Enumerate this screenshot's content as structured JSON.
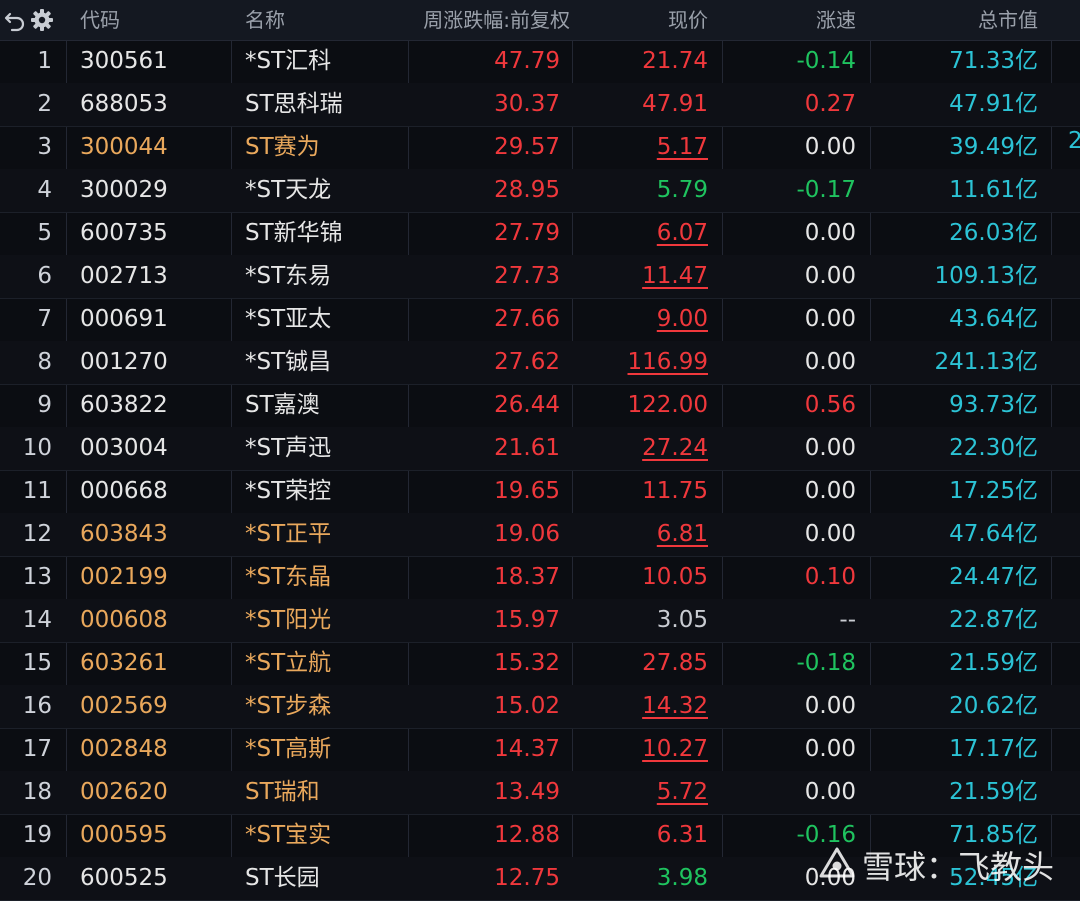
{
  "header": {
    "code": "代码",
    "name": "名称",
    "weekly_change": "周涨跌幅:前复权",
    "price": "现价",
    "speed": "涨速",
    "market_cap": "总市值"
  },
  "icons": {
    "refresh": "refresh-icon",
    "settings": "gear-icon"
  },
  "colors": {
    "red": "#f0383c",
    "green": "#1fc35f",
    "cyan": "#2cc3d5",
    "orange": "#e9a85c"
  },
  "rows": [
    {
      "idx": "1",
      "code": "300561",
      "name": "*ST汇科",
      "chg": "47.79",
      "price": "21.74",
      "price_color": "red",
      "price_ul": false,
      "speed": "-0.14",
      "speed_color": "green",
      "cap": "71.33亿",
      "name_color": "white"
    },
    {
      "idx": "2",
      "code": "688053",
      "name": "ST思科瑞",
      "chg": "30.37",
      "price": "47.91",
      "price_color": "red",
      "price_ul": false,
      "speed": "0.27",
      "speed_color": "red",
      "cap": "47.91亿",
      "name_color": "white"
    },
    {
      "idx": "3",
      "code": "300044",
      "name": "ST赛为",
      "chg": "29.57",
      "price": "5.17",
      "price_color": "red",
      "price_ul": true,
      "speed": "0.00",
      "speed_color": "white",
      "cap": "39.49亿",
      "name_color": "orange"
    },
    {
      "idx": "4",
      "code": "300029",
      "name": "*ST天龙",
      "chg": "28.95",
      "price": "5.79",
      "price_color": "green",
      "price_ul": false,
      "speed": "-0.17",
      "speed_color": "green",
      "cap": "11.61亿",
      "name_color": "white"
    },
    {
      "idx": "5",
      "code": "600735",
      "name": "ST新华锦",
      "chg": "27.79",
      "price": "6.07",
      "price_color": "red",
      "price_ul": true,
      "speed": "0.00",
      "speed_color": "white",
      "cap": "26.03亿",
      "name_color": "white"
    },
    {
      "idx": "6",
      "code": "002713",
      "name": "*ST东易",
      "chg": "27.73",
      "price": "11.47",
      "price_color": "red",
      "price_ul": true,
      "speed": "0.00",
      "speed_color": "white",
      "cap": "109.13亿",
      "name_color": "white"
    },
    {
      "idx": "7",
      "code": "000691",
      "name": "*ST亚太",
      "chg": "27.66",
      "price": "9.00",
      "price_color": "red",
      "price_ul": true,
      "speed": "0.00",
      "speed_color": "white",
      "cap": "43.64亿",
      "name_color": "white"
    },
    {
      "idx": "8",
      "code": "001270",
      "name": "*ST铖昌",
      "chg": "27.62",
      "price": "116.99",
      "price_color": "red",
      "price_ul": true,
      "speed": "0.00",
      "speed_color": "white",
      "cap": "241.13亿",
      "name_color": "white"
    },
    {
      "idx": "9",
      "code": "603822",
      "name": "ST嘉澳",
      "chg": "26.44",
      "price": "122.00",
      "price_color": "red",
      "price_ul": false,
      "speed": "0.56",
      "speed_color": "red",
      "cap": "93.73亿",
      "name_color": "white"
    },
    {
      "idx": "10",
      "code": "003004",
      "name": "*ST声迅",
      "chg": "21.61",
      "price": "27.24",
      "price_color": "red",
      "price_ul": true,
      "speed": "0.00",
      "speed_color": "white",
      "cap": "22.30亿",
      "name_color": "white"
    },
    {
      "idx": "11",
      "code": "000668",
      "name": "*ST荣控",
      "chg": "19.65",
      "price": "11.75",
      "price_color": "red",
      "price_ul": false,
      "speed": "0.00",
      "speed_color": "white",
      "cap": "17.25亿",
      "name_color": "white"
    },
    {
      "idx": "12",
      "code": "603843",
      "name": "*ST正平",
      "chg": "19.06",
      "price": "6.81",
      "price_color": "red",
      "price_ul": true,
      "speed": "0.00",
      "speed_color": "white",
      "cap": "47.64亿",
      "name_color": "orange"
    },
    {
      "idx": "13",
      "code": "002199",
      "name": "*ST东晶",
      "chg": "18.37",
      "price": "10.05",
      "price_color": "red",
      "price_ul": false,
      "speed": "0.10",
      "speed_color": "red",
      "cap": "24.47亿",
      "name_color": "orange"
    },
    {
      "idx": "14",
      "code": "000608",
      "name": "*ST阳光",
      "chg": "15.97",
      "price": "3.05",
      "price_color": "gray",
      "price_ul": false,
      "speed": "--",
      "speed_color": "gray",
      "cap": "22.87亿",
      "name_color": "orange"
    },
    {
      "idx": "15",
      "code": "603261",
      "name": "*ST立航",
      "chg": "15.32",
      "price": "27.85",
      "price_color": "red",
      "price_ul": false,
      "speed": "-0.18",
      "speed_color": "green",
      "cap": "21.59亿",
      "name_color": "orange"
    },
    {
      "idx": "16",
      "code": "002569",
      "name": "*ST步森",
      "chg": "15.02",
      "price": "14.32",
      "price_color": "red",
      "price_ul": true,
      "speed": "0.00",
      "speed_color": "white",
      "cap": "20.62亿",
      "name_color": "orange"
    },
    {
      "idx": "17",
      "code": "002848",
      "name": "*ST高斯",
      "chg": "14.37",
      "price": "10.27",
      "price_color": "red",
      "price_ul": true,
      "speed": "0.00",
      "speed_color": "white",
      "cap": "17.17亿",
      "name_color": "orange"
    },
    {
      "idx": "18",
      "code": "002620",
      "name": "ST瑞和",
      "chg": "13.49",
      "price": "5.72",
      "price_color": "red",
      "price_ul": true,
      "speed": "0.00",
      "speed_color": "white",
      "cap": "21.59亿",
      "name_color": "orange"
    },
    {
      "idx": "19",
      "code": "000595",
      "name": "*ST宝实",
      "chg": "12.88",
      "price": "6.31",
      "price_color": "red",
      "price_ul": false,
      "speed": "-0.16",
      "speed_color": "green",
      "cap": "71.85亿",
      "name_color": "orange"
    },
    {
      "idx": "20",
      "code": "600525",
      "name": "ST长园",
      "chg": "12.75",
      "price": "3.98",
      "price_color": "green",
      "price_ul": false,
      "speed": "0.00",
      "speed_color": "white",
      "cap": "52.45亿",
      "name_color": "white"
    }
  ],
  "edge_fragment": "2",
  "watermark": "雪球：飞教头"
}
